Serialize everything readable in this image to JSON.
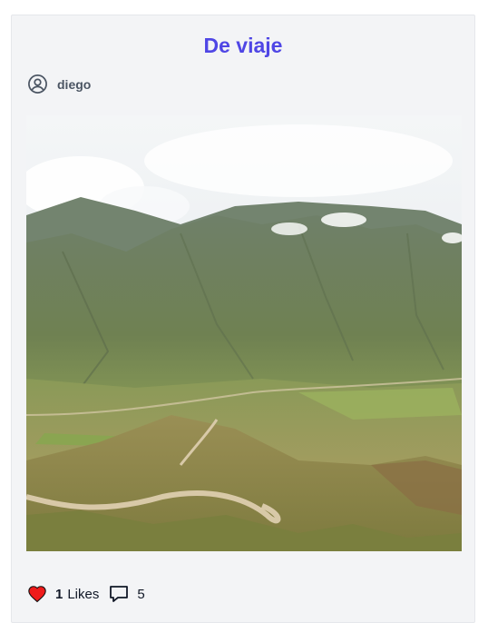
{
  "post": {
    "title": "De viaje",
    "author": {
      "name": "diego",
      "icon": "user-circle-icon"
    },
    "image": {
      "description": "mountain-valley-photo"
    },
    "likes": {
      "count": "1",
      "label": "Likes",
      "icon": "heart-icon",
      "color": "#ef1b1b"
    },
    "comments": {
      "count": "5",
      "icon": "comment-icon"
    }
  },
  "colors": {
    "title": "#4f46e5",
    "card_bg": "#f3f4f6",
    "author": "#4b5563"
  }
}
